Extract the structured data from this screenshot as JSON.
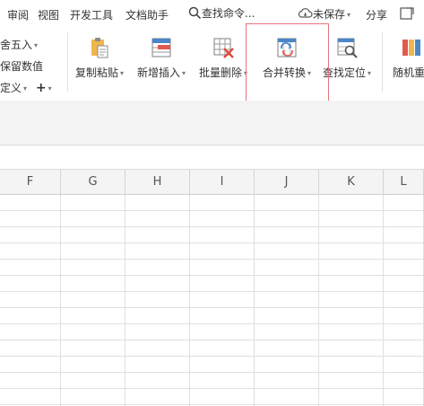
{
  "menu": {
    "tabs": [
      "审阅",
      "视图",
      "开发工具",
      "文档助手"
    ],
    "search": "查找命令...",
    "unsaved": "未保存",
    "share": "分享"
  },
  "ribbon": {
    "left_panel": {
      "round": "舍五入",
      "keep_values": "保留数值",
      "custom": "定义",
      "plus": "+"
    },
    "buttons": [
      {
        "label": "复制粘贴",
        "icon": "clipboard-icon"
      },
      {
        "label": "新增插入",
        "icon": "insert-row-icon"
      },
      {
        "label": "批量删除",
        "icon": "delete-grid-icon"
      },
      {
        "label": "合并转换",
        "icon": "merge-convert-icon"
      },
      {
        "label": "查找定位",
        "icon": "find-locate-icon"
      },
      {
        "label": "随机重",
        "icon": "random-icon"
      }
    ]
  },
  "columns": [
    "F",
    "G",
    "H",
    "I",
    "J",
    "K",
    "L"
  ],
  "accent": "#e8747a"
}
